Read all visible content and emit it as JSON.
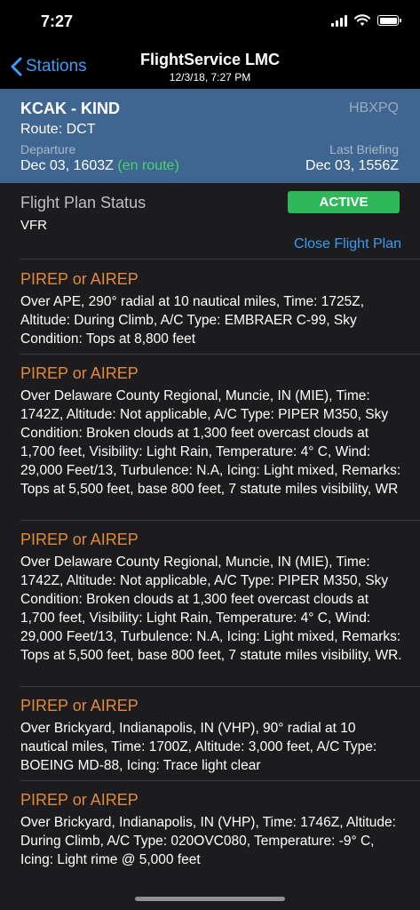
{
  "status_bar": {
    "time": "7:27",
    "icons": [
      "signal-icon",
      "wifi-icon",
      "battery-icon"
    ]
  },
  "nav": {
    "back_label": "Stations",
    "title": "FlightService LMC",
    "subtitle": "12/3/18, 7:27 PM"
  },
  "flight": {
    "title": "KCAK - KIND",
    "tail": "HBXPQ",
    "route": "Route: DCT",
    "departure_label": "Departure",
    "departure_value": "Dec 03, 1603Z",
    "departure_status": "(en route)",
    "last_briefing_label": "Last Briefing",
    "last_briefing_value": "Dec 03, 1556Z"
  },
  "flight_plan": {
    "title": "Flight Plan Status",
    "status": "ACTIVE",
    "rules": "VFR",
    "close_label": "Close Flight Plan"
  },
  "pireps": [
    {
      "title": "PIREP or AIREP",
      "body": "Over APE, 290° radial at 10 nautical miles, Time: 1725Z, Altitude: During Climb, A/C Type: EMBRAER C-99, Sky Condition: Tops at 8,800 feet"
    },
    {
      "title": "PIREP or AIREP",
      "body": "Over Delaware County Regional, Muncie, IN (MIE), Time: 1742Z, Altitude: Not applicable, A/C Type: PIPER M350, Sky Condition: Broken clouds at 1,300 feet overcast clouds at 1,700 feet, Visibility: Light Rain, Temperature: 4° C, Wind: 29,000 Feet/13, Turbulence: N.A, Icing: Light mixed, Remarks: Tops at 5,500 feet, base 800 feet, 7 statute miles visibility, WR"
    },
    {
      "title": "PIREP or AIREP",
      "body": "Over Delaware County Regional, Muncie, IN (MIE), Time: 1742Z, Altitude: Not applicable, A/C Type: PIPER M350, Sky Condition: Broken clouds at 1,300 feet overcast clouds at 1,700 feet, Visibility: Light Rain, Temperature: 4° C, Wind: 29,000 Feet/13, Turbulence: N.A, Icing: Light mixed, Remarks: Tops at 5,500 feet, base 800 feet, 7 statute miles visibility, WR."
    },
    {
      "title": "PIREP or AIREP",
      "body": "Over Brickyard, Indianapolis, IN (VHP), 90° radial at 10 nautical miles, Time: 1700Z, Altitude: 3,000 feet, A/C Type: BOEING MD-88, Icing: Trace light clear"
    },
    {
      "title": "PIREP or AIREP",
      "body": "Over Brickyard, Indianapolis, IN (VHP), Time: 1746Z, Altitude: During Climb, A/C Type: 020OVC080, Temperature: -9° C, Icing: Light rime @ 5,000 feet"
    }
  ],
  "colors": {
    "accent": "#3a9cf2",
    "header_bg": "#3f6690",
    "active_badge": "#2fb85a",
    "en_route": "#4cd26a",
    "pirep_title": "#e08a3a",
    "background": "#1c1c1e"
  }
}
